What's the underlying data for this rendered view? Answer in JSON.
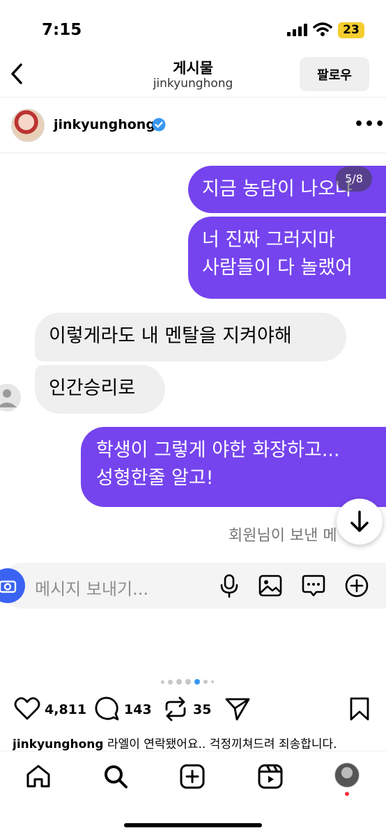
{
  "status_bar": {
    "time": "7:15",
    "battery": "23"
  },
  "header": {
    "title": "게시물",
    "subtitle": "jinkyunghong",
    "follow_label": "팔로우"
  },
  "author": {
    "username": "jinkyunghong"
  },
  "chat": {
    "counter": "5/8",
    "messages": [
      {
        "side": "out",
        "text": "지금 농담이 나오냐"
      },
      {
        "side": "out",
        "lines": [
          "너 진짜 그러지마",
          "사람들이 다 놀랬어"
        ]
      },
      {
        "side": "in",
        "text": "이렇게라도 내 멘탈을 지켜야해"
      },
      {
        "side": "in",
        "text": "인간승리로"
      },
      {
        "side": "out",
        "lines": [
          "학생이 그렇게 야한 화장하고...",
          "성형한줄 알고!"
        ]
      }
    ],
    "sent_note": "회원님이 보낸 메",
    "composer_placeholder": "메시지 보내기..."
  },
  "carousel": {
    "current_index": 4,
    "total_dots": 6
  },
  "actions": {
    "likes": "4,811",
    "comments": "143",
    "reposts": "35"
  },
  "caption": {
    "username": "jinkyunghong",
    "text": "라엘이 연락됐어요.. 걱정끼쳐드려 죄송합니다."
  },
  "colors": {
    "outgoing_bubble": "#7544ee",
    "incoming_bubble": "#efefef",
    "verified": "#3897f0",
    "camera": "#3a63f2"
  }
}
